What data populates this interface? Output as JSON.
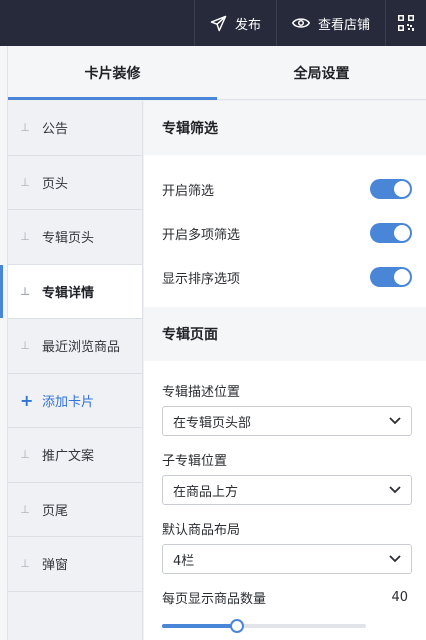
{
  "topbar": {
    "publish_label": "发布",
    "publish_icon": "send-icon",
    "view_store_label": "查看店铺",
    "view_store_icon": "eye-icon",
    "qr_icon": "qr-code-icon"
  },
  "tabs": [
    {
      "label": "卡片装修",
      "active": true
    },
    {
      "label": "全局设置",
      "active": false
    }
  ],
  "sidebar": {
    "items": [
      {
        "label": "公告"
      },
      {
        "label": "页头"
      },
      {
        "label": "专辑页头"
      },
      {
        "label": "专辑详情",
        "active": true
      },
      {
        "label": "最近浏览商品"
      },
      {
        "label": "添加卡片",
        "type": "add"
      },
      {
        "label": "推广文案"
      },
      {
        "label": "页尾"
      },
      {
        "label": "弹窗"
      }
    ]
  },
  "main": {
    "filter_section": {
      "title": "专辑筛选",
      "toggles": [
        {
          "label": "开启筛选",
          "on": true
        },
        {
          "label": "开启多项筛选",
          "on": true
        },
        {
          "label": "显示排序选项",
          "on": true
        }
      ]
    },
    "page_section": {
      "title": "专辑页面",
      "desc_position": {
        "label": "专辑描述位置",
        "value": "在专辑页头部"
      },
      "sub_position": {
        "label": "子专辑位置",
        "value": "在商品上方"
      },
      "layout": {
        "label": "默认商品布局",
        "value": "4栏"
      },
      "per_page": {
        "label": "每页显示商品数量",
        "value": "40",
        "slider_fraction": 0.37
      }
    }
  },
  "colors": {
    "accent": "#4a86d8",
    "topbar_bg": "#262a3b"
  }
}
